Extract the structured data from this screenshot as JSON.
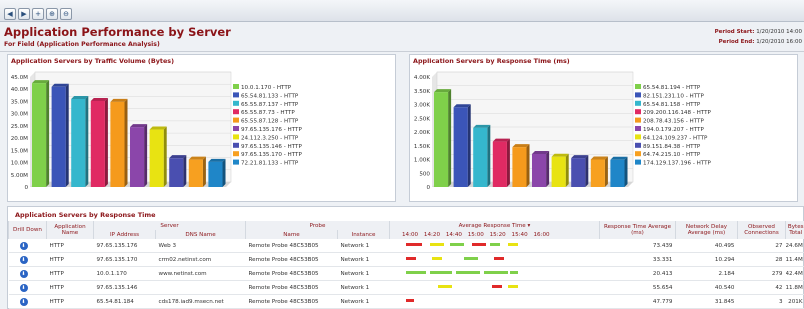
{
  "header": {
    "title": "Application Performance by Server",
    "subtitle": "For Field (Application Performance Analysis)",
    "period_start_label": "Period Start:",
    "period_start": "1/20/2010 14:00",
    "period_end_label": "Period End:",
    "period_end": "1/20/2010 16:00"
  },
  "colors": {
    "accent": "#8b1418",
    "series": [
      "#7fd04a",
      "#3b55b8",
      "#35b7cd",
      "#e02a63",
      "#f59a1c",
      "#8b46aa",
      "#e8e312",
      "#4a4fb0",
      "#f7a020",
      "#1f86c8"
    ]
  },
  "chart_data": [
    {
      "type": "bar",
      "title": "Application Servers by Traffic Volume (Bytes)",
      "categories": [
        "10.0.1.170 - HTTP",
        "65.54.81.133 - HTTP",
        "65.55.87.137 - HTTP",
        "65.55.87.73 - HTTP",
        "65.55.87.128 - HTTP",
        "97.65.135.176 - HTTP",
        "24.112.3.250 - HTTP",
        "97.65.135.146 - HTTP",
        "97.65.135.170 - HTTP",
        "72.21.81.133 - HTTP"
      ],
      "values": [
        42500000,
        41000000,
        36000000,
        35200000,
        34800000,
        24500000,
        23500000,
        11800000,
        11200000,
        10300000
      ],
      "ylim": [
        0,
        45000000
      ],
      "yticks": [
        "0",
        "5.00M",
        "10.0M",
        "15.0M",
        "20.0M",
        "25.0M",
        "30.0M",
        "35.0M",
        "40.0M",
        "45.0M"
      ],
      "legend": "right"
    },
    {
      "type": "bar",
      "title": "Application Servers by Response Time (ms)",
      "categories": [
        "65.54.81.194 - HTTP",
        "82.151.231.10 - HTTP",
        "65.54.81.158 - HTTP",
        "209.200.116.148 - HTTP",
        "208.78.43.156 - HTTP",
        "194.0.179.207 - HTTP",
        "64.124.109.237 - HTTP",
        "89.151.84.38 - HTTP",
        "64.74.215.10 - HTTP",
        "174.129.137.196 - HTTP"
      ],
      "values": [
        3450,
        2900,
        2150,
        1650,
        1450,
        1200,
        1100,
        1050,
        1000,
        990
      ],
      "ylim": [
        0,
        4000
      ],
      "yticks": [
        "0",
        "500",
        "1.00K",
        "1.50K",
        "2.00K",
        "2.50K",
        "3.00K",
        "3.50K",
        "4.00K"
      ],
      "legend": "right"
    }
  ],
  "table": {
    "title": "Application Servers by Response Time",
    "group_headers": {
      "server": "Server",
      "probe": "Probe",
      "avg_response": "Average Response Time"
    },
    "timeline_ticks": [
      "14:00",
      "14:20",
      "14:40",
      "15:00",
      "15:20",
      "15:40",
      "16:00"
    ],
    "headers": {
      "drill": "Drill Down",
      "app": "Application Name",
      "ip": "IP Address",
      "dns": "DNS Name",
      "probe_name": "Name",
      "instance": "Instance",
      "resp": "Response Time Average (ms)",
      "delay": "Network Delay Average (ms)",
      "conn": "Observed Connections",
      "bytes": "Bytes Total"
    },
    "rows": [
      {
        "app": "HTTP",
        "ip": "97.65.135.176",
        "dns": "Web 3",
        "probe": "Remote Probe 48C53B05",
        "instance": "Network 1",
        "resp": "73.439",
        "delay": "40.495",
        "conn": "27",
        "bytes": "24.6M"
      },
      {
        "app": "HTTP",
        "ip": "97.65.135.170",
        "dns": "crm02.netinst.com",
        "probe": "Remote Probe 48C53B05",
        "instance": "Network 1",
        "resp": "33.331",
        "delay": "10.294",
        "conn": "28",
        "bytes": "11.4M"
      },
      {
        "app": "HTTP",
        "ip": "10.0.1.170",
        "dns": "www.netinst.com",
        "probe": "Remote Probe 48C53B05",
        "instance": "Network 1",
        "resp": "20.413",
        "delay": "2.184",
        "conn": "279",
        "bytes": "42.4M"
      },
      {
        "app": "HTTP",
        "ip": "97.65.135.146",
        "dns": "",
        "probe": "Remote Probe 48C53B05",
        "instance": "Network 1",
        "resp": "55.654",
        "delay": "40.540",
        "conn": "42",
        "bytes": "11.8M"
      },
      {
        "app": "HTTP",
        "ip": "65.54.81.184",
        "dns": "cds178.iad9.msecn.net",
        "probe": "Remote Probe 48C53B05",
        "instance": "Network 1",
        "resp": "47.779",
        "delay": "31.845",
        "conn": "3",
        "bytes": "201K"
      }
    ]
  }
}
